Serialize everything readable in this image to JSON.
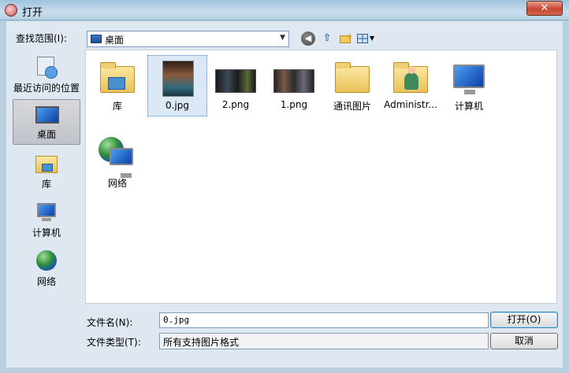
{
  "window": {
    "title": "打开",
    "close_glyph": "✕"
  },
  "toolbar": {
    "look_in_label": "查找范围(I):",
    "look_in_value": "桌面",
    "back_glyph": "◀",
    "up_glyph": "⇧",
    "new_folder_glyph": "✶",
    "view_glyph": "▼"
  },
  "places": [
    {
      "label": "最近访问的位置",
      "icon": "recent-places-icon"
    },
    {
      "label": "桌面",
      "icon": "desktop-icon",
      "selected": true
    },
    {
      "label": "库",
      "icon": "library-icon"
    },
    {
      "label": "计算机",
      "icon": "computer-icon"
    },
    {
      "label": "网络",
      "icon": "network-icon"
    }
  ],
  "files": [
    {
      "name": "库",
      "icon": "library-folder-icon"
    },
    {
      "name": "0.jpg",
      "icon": "image-thumbnail-icon",
      "selected": true
    },
    {
      "name": "2.png",
      "icon": "screenshot-thumbnail-icon"
    },
    {
      "name": "1.png",
      "icon": "screenshot-thumbnail-icon"
    },
    {
      "name": "通讯图片",
      "icon": "folder-icon"
    },
    {
      "name": "Administr...",
      "icon": "user-folder-icon"
    },
    {
      "name": "计算机",
      "icon": "computer-icon"
    },
    {
      "name": "网络",
      "icon": "network-icon"
    }
  ],
  "bottom": {
    "filename_label": "文件名(N):",
    "filename_value": "0.jpg",
    "filetype_label": "文件类型(T):",
    "filetype_value": "所有支持图片格式",
    "open_label": "打开(O)",
    "cancel_label": "取消"
  }
}
